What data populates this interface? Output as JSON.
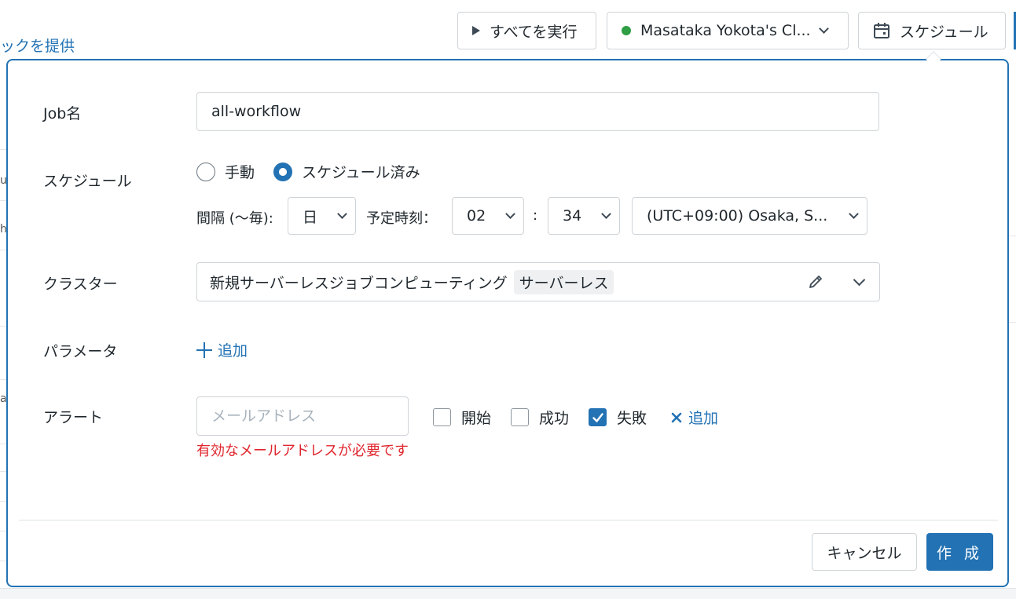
{
  "background": {
    "link_fragment": "ックを提供",
    "side_fragments": [
      "u",
      "h",
      "a"
    ]
  },
  "toolbar": {
    "run_all_label": "すべてを実行",
    "cluster_label": "Masataka Yokota's Cl...",
    "schedule_label": "スケジュール"
  },
  "form": {
    "job_name": {
      "label": "Job名",
      "value": "all-workflow"
    },
    "schedule": {
      "label": "スケジュール",
      "options": [
        "手動",
        "スケジュール済み"
      ],
      "selected": "スケジュール済み",
      "interval_label": "間隔 (〜毎):",
      "interval_value": "日",
      "time_label": "予定時刻：",
      "hour": "02",
      "colon": ":",
      "minute": "34",
      "timezone": "(UTC+09:00) Osaka, S..."
    },
    "cluster": {
      "label": "クラスター",
      "value": "新規サーバーレスジョブコンピューティング",
      "tag": "サーバーレス"
    },
    "parameters": {
      "label": "パラメータ",
      "add_label": "追加"
    },
    "alert": {
      "label": "アラート",
      "email_placeholder": "メールアドレス",
      "checks": [
        {
          "label": "開始",
          "checked": false
        },
        {
          "label": "成功",
          "checked": false
        },
        {
          "label": "失敗",
          "checked": true
        }
      ],
      "add_label": "追加",
      "error": "有効なメールアドレスが必要です"
    }
  },
  "footer": {
    "cancel_label": "キャンセル",
    "create_label": "作 成"
  },
  "colors": {
    "accent": "#2272b4",
    "error": "#e0262d",
    "status_green": "#2f9e44"
  }
}
